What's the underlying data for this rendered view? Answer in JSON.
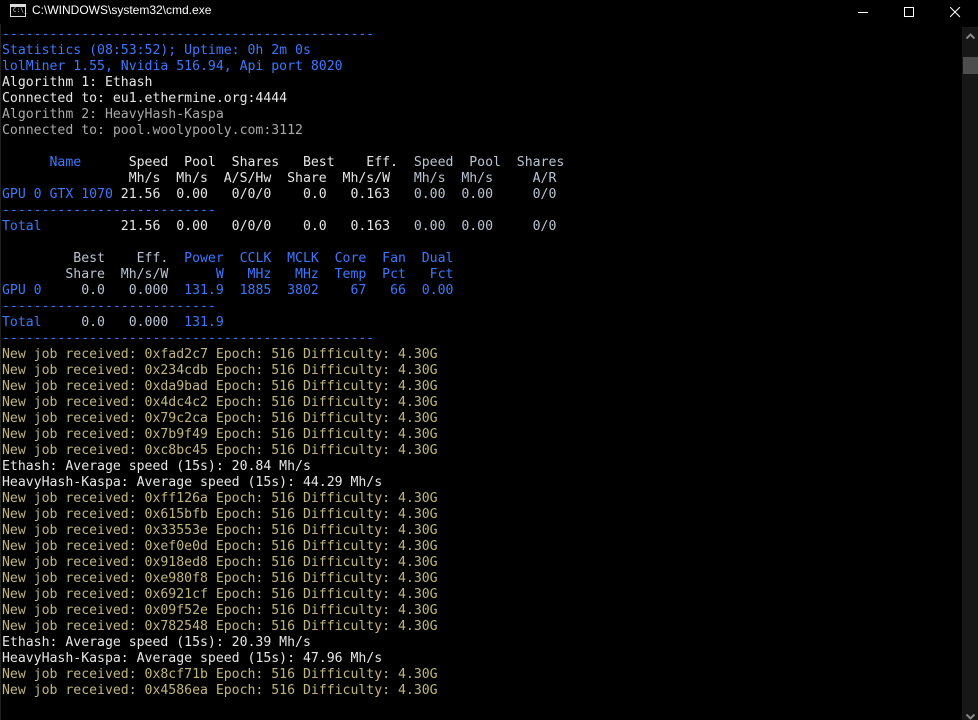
{
  "window": {
    "title": "C:\\WINDOWS\\system32\\cmd.exe",
    "icon": "console-icon",
    "icon_text": "C:\\_",
    "controls": [
      "minimize",
      "maximize",
      "close"
    ]
  },
  "colors": {
    "blue": "#3b78ff",
    "white": "#e6e6e6",
    "grey": "#b9c3d3",
    "dim": "#a9a9a9",
    "yellow": "#c1b67c",
    "background": "#000000"
  },
  "console": {
    "header": {
      "separator": "-----------------------------------------------",
      "statistics": "Statistics (08:53:52); Uptime: 0h 2m 0s",
      "version": "lolMiner 1.55, Nvidia 516.94, Api port 8020",
      "algorithm1": "Algorithm 1: Ethash",
      "connected1": "Connected to: eu1.ethermine.org:4444",
      "algorithm2": "Algorithm 2: HeavyHash-Kaspa",
      "connected2": "Connected to: pool.woolypooly.com:3112"
    },
    "table1": {
      "header1": {
        "name": "      Name     ",
        "algo1": " Speed  Pool  Shares   Best    Eff.",
        "algo2": "  Speed  Pool  Shares"
      },
      "header2": {
        "name": "               ",
        "algo1": " Mh/s  Mh/s  A/S/Hw  Share  Mh/s/W",
        "algo2": "   Mh/s  Mh/s     A/R"
      },
      "gpu_row": {
        "name": "GPU 0 GTX 1070",
        "algo1": " 21.56  0.00   0/0/0    0.0   0.163",
        "algo2": "   0.00  0.00     0/0"
      },
      "separator": "---------------------------",
      "total_row": {
        "name": "Total         ",
        "algo1": " 21.56  0.00   0/0/0    0.0   0.163",
        "algo2": "   0.00  0.00     0/0"
      }
    },
    "table2": {
      "header1": {
        "pad": "        ",
        "grey": " Best    Eff.",
        "blue": "  Power  CCLK  MCLK  Core  Fan  Dual"
      },
      "header2": {
        "pad": "        ",
        "grey": "Share  Mh/s/W",
        "blue": "      W   MHz   MHz  Temp  Pct   Fct"
      },
      "gpu_row": {
        "name": "GPU 0   ",
        "grey": "  0.0   0.000",
        "blue": "  131.9  1885  3802    67   66  0.00"
      },
      "separator": "---------------------------",
      "total_row": {
        "name": "Total   ",
        "grey": "  0.0   0.000",
        "blue": "  131.9"
      },
      "end_separator": "-----------------------------------------------"
    },
    "log": [
      {
        "type": "job",
        "text": "New job received: 0xfad2c7 Epoch: 516 Difficulty: 4.30G"
      },
      {
        "type": "job",
        "text": "New job received: 0x234cdb Epoch: 516 Difficulty: 4.30G"
      },
      {
        "type": "job",
        "text": "New job received: 0xda9bad Epoch: 516 Difficulty: 4.30G"
      },
      {
        "type": "job",
        "text": "New job received: 0x4dc4c2 Epoch: 516 Difficulty: 4.30G"
      },
      {
        "type": "job",
        "text": "New job received: 0x79c2ca Epoch: 516 Difficulty: 4.30G"
      },
      {
        "type": "job",
        "text": "New job received: 0x7b9f49 Epoch: 516 Difficulty: 4.30G"
      },
      {
        "type": "job",
        "text": "New job received: 0xc8bc45 Epoch: 516 Difficulty: 4.30G"
      },
      {
        "type": "speed",
        "text": "Ethash: Average speed (15s): 20.84 Mh/s"
      },
      {
        "type": "speed",
        "text": "HeavyHash-Kaspa: Average speed (15s): 44.29 Mh/s"
      },
      {
        "type": "job",
        "text": "New job received: 0xff126a Epoch: 516 Difficulty: 4.30G"
      },
      {
        "type": "job",
        "text": "New job received: 0x615bfb Epoch: 516 Difficulty: 4.30G"
      },
      {
        "type": "job",
        "text": "New job received: 0x33553e Epoch: 516 Difficulty: 4.30G"
      },
      {
        "type": "job",
        "text": "New job received: 0xef0e0d Epoch: 516 Difficulty: 4.30G"
      },
      {
        "type": "job",
        "text": "New job received: 0x918ed8 Epoch: 516 Difficulty: 4.30G"
      },
      {
        "type": "job",
        "text": "New job received: 0xe980f8 Epoch: 516 Difficulty: 4.30G"
      },
      {
        "type": "job",
        "text": "New job received: 0x6921cf Epoch: 516 Difficulty: 4.30G"
      },
      {
        "type": "job",
        "text": "New job received: 0x09f52e Epoch: 516 Difficulty: 4.30G"
      },
      {
        "type": "job",
        "text": "New job received: 0x782548 Epoch: 516 Difficulty: 4.30G"
      },
      {
        "type": "speed",
        "text": "Ethash: Average speed (15s): 20.39 Mh/s"
      },
      {
        "type": "speed",
        "text": "HeavyHash-Kaspa: Average speed (15s): 47.96 Mh/s"
      },
      {
        "type": "job",
        "text": "New job received: 0x8cf71b Epoch: 516 Difficulty: 4.30G"
      },
      {
        "type": "job",
        "text": "New job received: 0x4586ea Epoch: 516 Difficulty: 4.30G"
      }
    ]
  }
}
